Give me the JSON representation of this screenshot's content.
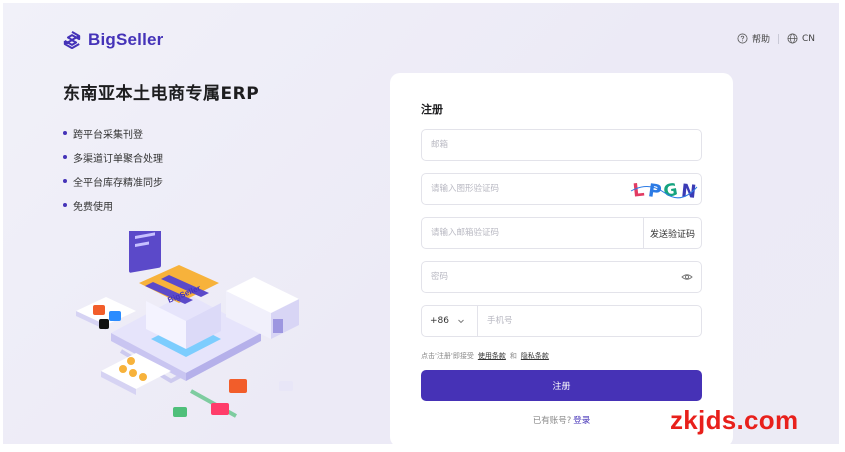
{
  "header": {
    "brand": "BigSeller",
    "help_label": "帮助",
    "lang_label": "CN"
  },
  "hero": {
    "headline": "东南亚本土电商专属ERP",
    "features": [
      "跨平台采集刊登",
      "多渠道订单聚合处理",
      "全平台库存精准同步",
      "免费使用"
    ],
    "illustration_brand": "BigSeller"
  },
  "form": {
    "title": "注册",
    "email_placeholder": "邮箱",
    "captcha_placeholder": "请输入图形验证码",
    "captcha_text": "LPGN",
    "email_code_placeholder": "请输入邮箱验证码",
    "send_code_label": "发送验证码",
    "password_placeholder": "密码",
    "phone_prefix": "+86",
    "phone_placeholder": "手机号",
    "terms_prefix": "点击'注册'即接受",
    "terms_link": "使用条款",
    "terms_and": "和",
    "privacy_link": "隐私条款",
    "submit_label": "注册",
    "has_account": "已有账号?",
    "login_link": "登录"
  },
  "watermark": "zkjds.com",
  "colors": {
    "brand": "#4533b8",
    "button": "#4632b6",
    "watermark": "#e8201b"
  }
}
